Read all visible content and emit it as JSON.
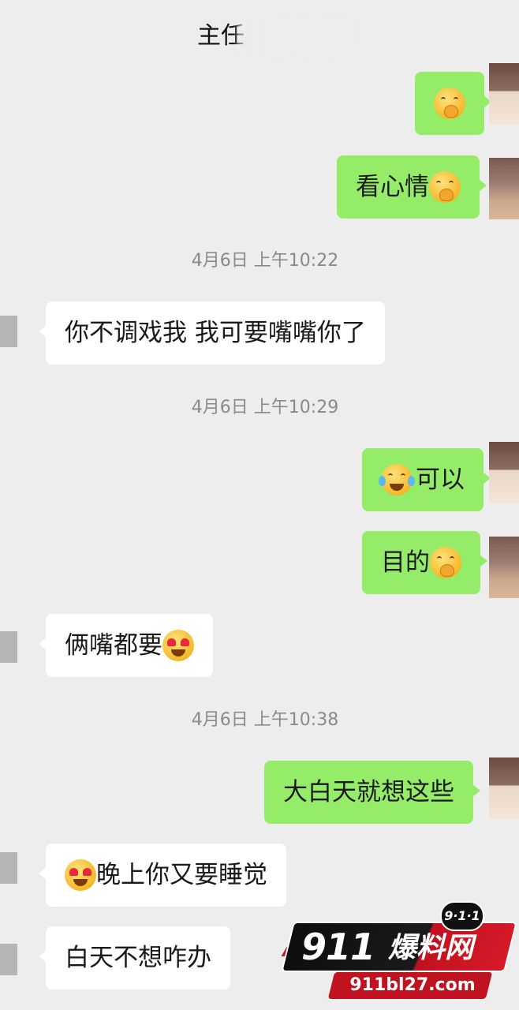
{
  "header": {
    "title": "主任"
  },
  "messages": [
    {
      "type": "out",
      "text": "",
      "emoji": "smirk-emoji"
    },
    {
      "type": "out",
      "text": "看心情",
      "emoji": "smirk-emoji"
    },
    {
      "type": "time",
      "text": "4月6日 上午10:22"
    },
    {
      "type": "in",
      "text": "你不调戏我 我可要嘴嘴你了"
    },
    {
      "type": "time",
      "text": "4月6日 上午10:29"
    },
    {
      "type": "out",
      "text": "可以",
      "emoji_before": "laughing-crying-emoji"
    },
    {
      "type": "out",
      "text": "目的",
      "emoji": "smirk-emoji"
    },
    {
      "type": "in",
      "text": "俩嘴都要",
      "emoji": "heart-eyes-emoji"
    },
    {
      "type": "time",
      "text": "4月6日 上午10:38"
    },
    {
      "type": "out",
      "text": "大白天就想这些"
    },
    {
      "type": "in",
      "text": "晚上你又要睡觉",
      "emoji_before": "heart-eyes-emoji"
    },
    {
      "type": "in",
      "text": "白天不想咋办"
    }
  ],
  "watermark": {
    "badge": "9·1·1",
    "number": "911",
    "name": "爆料网",
    "url": "911bl27.com"
  },
  "colors": {
    "background": "#ededed",
    "outgoing_bubble": "#95ec69",
    "incoming_bubble": "#ffffff",
    "timestamp": "#8a8a8a",
    "watermark_red": "#c1121f"
  }
}
